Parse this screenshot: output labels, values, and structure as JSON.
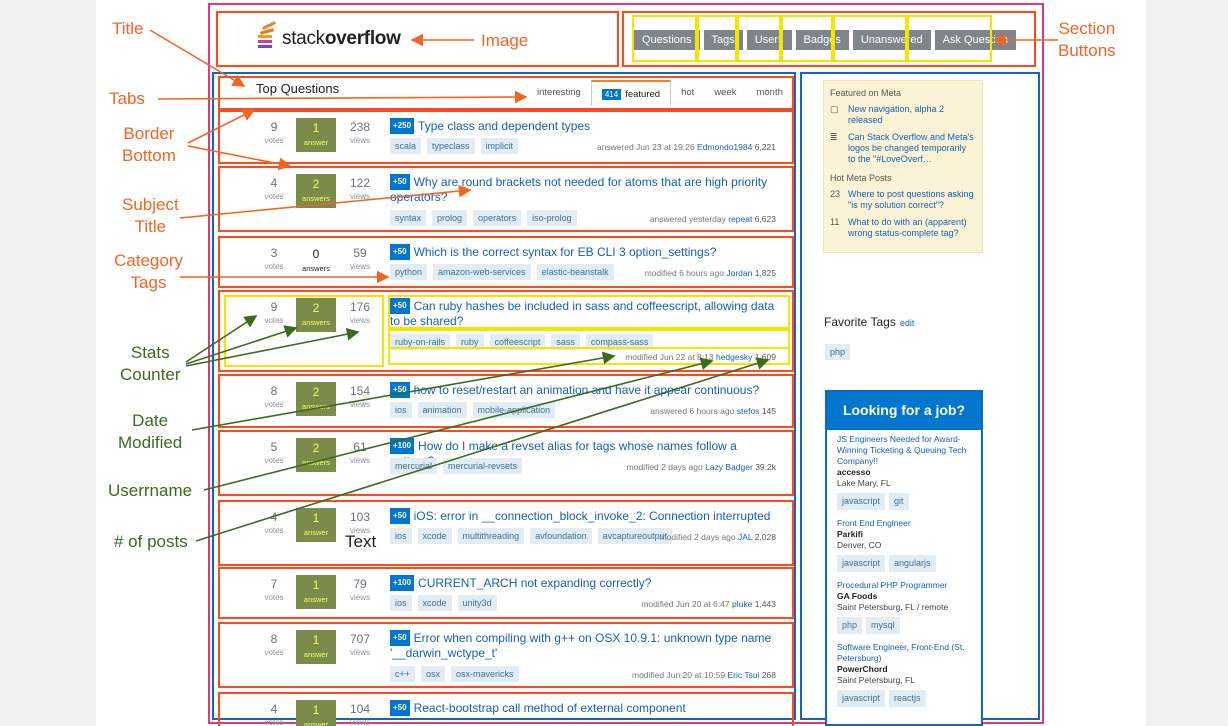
{
  "logo": {
    "prefix": "stack",
    "suffix": "overflow"
  },
  "section_buttons": [
    "Questions",
    "Tags",
    "Users",
    "Badges",
    "Unanswered",
    "Ask Question"
  ],
  "top_questions_title": "Top Questions",
  "tabs": [
    {
      "label": "interesting"
    },
    {
      "label": "featured",
      "count": "414"
    },
    {
      "label": "hot"
    },
    {
      "label": "week"
    },
    {
      "label": "month"
    }
  ],
  "questions": [
    {
      "votes": "9",
      "answers": "1",
      "answers_label": "answer",
      "views": "238",
      "bounty": "+250",
      "title": "Type class and dependent types",
      "tags": [
        "scala",
        "typeclass",
        "implicit"
      ],
      "meta_text": "answered Jun 23 at 19:26",
      "user": "Edmondo1984",
      "rep": "6,221"
    },
    {
      "votes": "4",
      "answers": "2",
      "answers_label": "answers",
      "views": "122",
      "bounty": "+50",
      "title": "Why are round brackets not needed for atoms that are high priority operators?",
      "tags": [
        "syntax",
        "prolog",
        "operators",
        "iso-prolog"
      ],
      "meta_text": "answered yesterday",
      "user": "repeat",
      "rep": "6,623"
    },
    {
      "votes": "3",
      "answers": "0",
      "answers_label": "answers",
      "views": "59",
      "bounty": "+50",
      "title": "Which is the correct syntax for EB CLI 3 option_settings?",
      "tags": [
        "python",
        "amazon-web-services",
        "elastic-beanstalk"
      ],
      "meta_text": "modified 6 hours ago",
      "user": "Jordan",
      "rep": "1,825"
    },
    {
      "votes": "9",
      "answers": "2",
      "answers_label": "answers",
      "views": "176",
      "bounty": "+50",
      "title": "Can ruby hashes be included in sass and coffeescript, allowing data to be shared?",
      "tags": [
        "ruby-on-rails",
        "ruby",
        "coffeescript",
        "sass",
        "compass-sass"
      ],
      "meta_text": "modified Jun 22 at 8:13",
      "user": "hedgesky",
      "rep": "1,609"
    },
    {
      "votes": "8",
      "answers": "2",
      "answers_label": "answers",
      "views": "154",
      "bounty": "+50",
      "title": "how to reset/restart an animation and have it appear continuous?",
      "tags": [
        "ios",
        "animation",
        "mobile-application"
      ],
      "meta_text": "answered 6 hours ago",
      "user": "stefos",
      "rep": "145"
    },
    {
      "votes": "5",
      "answers": "2",
      "answers_label": "answers",
      "views": "61",
      "bounty": "+100",
      "title": "How do I make a revset alias for tags whose names follow a pattern?",
      "tags": [
        "mercurial",
        "mercurial-revsets"
      ],
      "meta_text": "modified 2 days ago",
      "user": "Lazy Badger",
      "rep": "39.2k"
    },
    {
      "votes": "4",
      "answers": "1",
      "answers_label": "answer",
      "views": "103",
      "bounty": "+50",
      "title": "iOS: error in __connection_block_invoke_2: Connection interrupted",
      "tags": [
        "ios",
        "xcode",
        "multithreading",
        "avfoundation",
        "avcaptureoutput"
      ],
      "meta_text": "modified 2 days ago",
      "user": "JAL",
      "rep": "2,028"
    },
    {
      "votes": "7",
      "answers": "1",
      "answers_label": "answer",
      "views": "79",
      "bounty": "+100",
      "title": "CURRENT_ARCH not expanding correctly?",
      "tags": [
        "ios",
        "xcode",
        "unity3d"
      ],
      "meta_text": "modified Jun 20 at 6:47",
      "user": "pluke",
      "rep": "1,443"
    },
    {
      "votes": "8",
      "answers": "1",
      "answers_label": "answer",
      "views": "707",
      "bounty": "+50",
      "title": "Error when compiling with g++ on OSX 10.9.1: unknown type name '__darwin_wctype_t'",
      "tags": [
        "c++",
        "osx",
        "osx-mavericks"
      ],
      "meta_text": "modified Jun 20 at 10:59",
      "user": "Eric Tsui",
      "rep": "268"
    },
    {
      "votes": "4",
      "answers": "1",
      "answers_label": "answer",
      "views": "104",
      "bounty": "+50",
      "title": "React-bootstrap call method of external component",
      "tags": [],
      "meta_text": "",
      "user": "",
      "rep": ""
    }
  ],
  "stat_labels": {
    "votes": "votes",
    "views": "views"
  },
  "meta_sidebar": {
    "featured_heading": "Featured on Meta",
    "featured": [
      "New navigation, alpha 2 released",
      "Can Stack Overflow and Meta's logos be changed temporarily to the \"#LoveOverf…"
    ],
    "hot_heading": "Hot Meta Posts",
    "hot": [
      {
        "count": "23",
        "title": "Where to post questions asking \"is my solution correct\"?"
      },
      {
        "count": "11",
        "title": "What to do with an (apparent) wrong status-complete tag?"
      }
    ]
  },
  "favorite_tags": {
    "label": "Favorite Tags",
    "edit": "edit",
    "tags": [
      "php"
    ]
  },
  "jobs": {
    "heading": "Looking for a job?",
    "items": [
      {
        "title": "JS Engineers Needed for Award-Winning Ticketing & Queuing Tech Company!!",
        "company": "accesso",
        "location": "Lake Mary, FL",
        "tags": [
          "javascript",
          "git"
        ]
      },
      {
        "title": "Front End Engineer",
        "company": "Parkifi",
        "location": "Denver, CO",
        "tags": [
          "javascript",
          "angularjs"
        ]
      },
      {
        "title": "Procedural PHP Programmer",
        "company": "GA Foods",
        "location": "Saint Petersburg, FL / remote",
        "tags": [
          "php",
          "mysql"
        ]
      },
      {
        "title": "Software Engineer, Front-End (St. Petersburg)",
        "company": "PowerChord",
        "location": "Saint Petersburg, FL",
        "tags": [
          "javascript",
          "reactjs"
        ]
      }
    ]
  },
  "annotations": {
    "title": "Title",
    "image": "Image",
    "section_buttons": "Section\nButtons",
    "tabs": "Tabs",
    "border_bottom": "Border\nBottom",
    "subject_title": "Subject\nTitle",
    "category_tags": "Category\nTags",
    "stats_counter": "Stats\nCounter",
    "date_modified": "Date\nModified",
    "username": "Userrname",
    "num_posts": "# of posts",
    "text": "Text"
  },
  "colors": {
    "annotation_orange": "#f26522",
    "annotation_green": "#3c6b20",
    "box_red": "#ff4a1a",
    "box_blue": "#1565c0",
    "box_yellow": "#f5e600",
    "box_pink": "#e3367f",
    "link_blue": "#1560bd"
  }
}
